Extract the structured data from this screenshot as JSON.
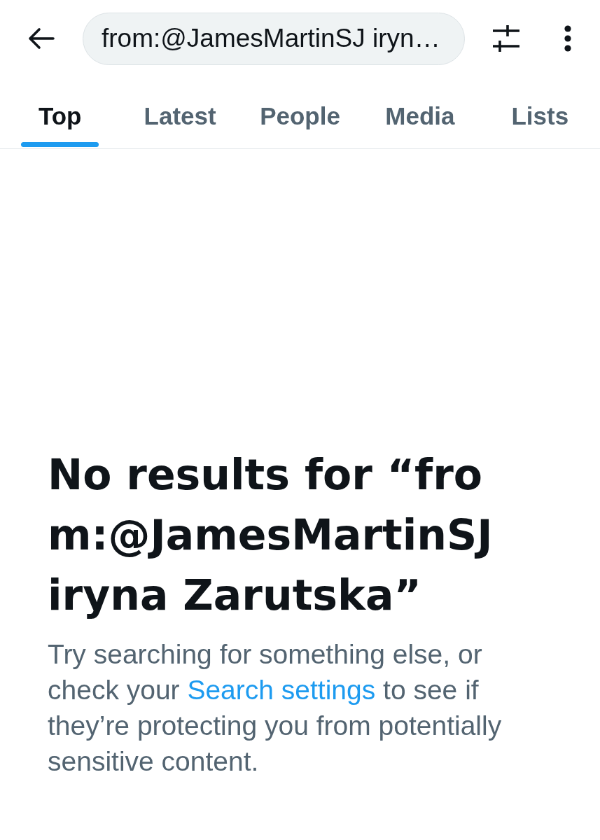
{
  "search_bar": {
    "value": "from:@JamesMartinSJ iryn…"
  },
  "tabs": [
    {
      "label": "Top",
      "selected": true
    },
    {
      "label": "Latest",
      "selected": false
    },
    {
      "label": "People",
      "selected": false
    },
    {
      "label": "Media",
      "selected": false
    },
    {
      "label": "Lists",
      "selected": false
    }
  ],
  "empty_state": {
    "title": "No results for “from:@JamesMartinSJ iryna Zarutska”",
    "message": {
      "text_before": "Try searching for something else, or check your ",
      "link": "Search settings",
      "text_after": " to see if they’re protecting you from potentially sensitive content."
    }
  }
}
